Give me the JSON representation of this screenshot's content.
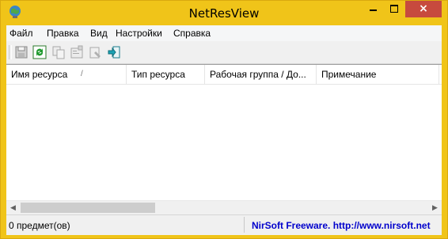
{
  "window": {
    "title": "NetResView",
    "close_glyph": "×"
  },
  "menu": {
    "items": [
      "Файл",
      "Правка",
      "Вид",
      "Настройки",
      "Справка"
    ]
  },
  "toolbar": {
    "icons": [
      "save-icon",
      "refresh-icon",
      "copy-icon",
      "properties-icon",
      "open-explorer-icon",
      "exit-icon"
    ]
  },
  "table": {
    "columns": [
      "Имя ресурса",
      "Тип ресурса",
      "Рабочая группа / До...",
      "Примечание",
      ""
    ],
    "sort_indicator": "/"
  },
  "scrollbar": {
    "left_arrow": "◀",
    "right_arrow": "▶"
  },
  "status": {
    "count_text": "0 предмет(ов)",
    "link_text": "NirSoft Freeware.  http://www.nirsoft.net"
  },
  "colors": {
    "title_bar": "#f0c419",
    "close_button": "#c74a3e",
    "link": "#0000cc"
  }
}
